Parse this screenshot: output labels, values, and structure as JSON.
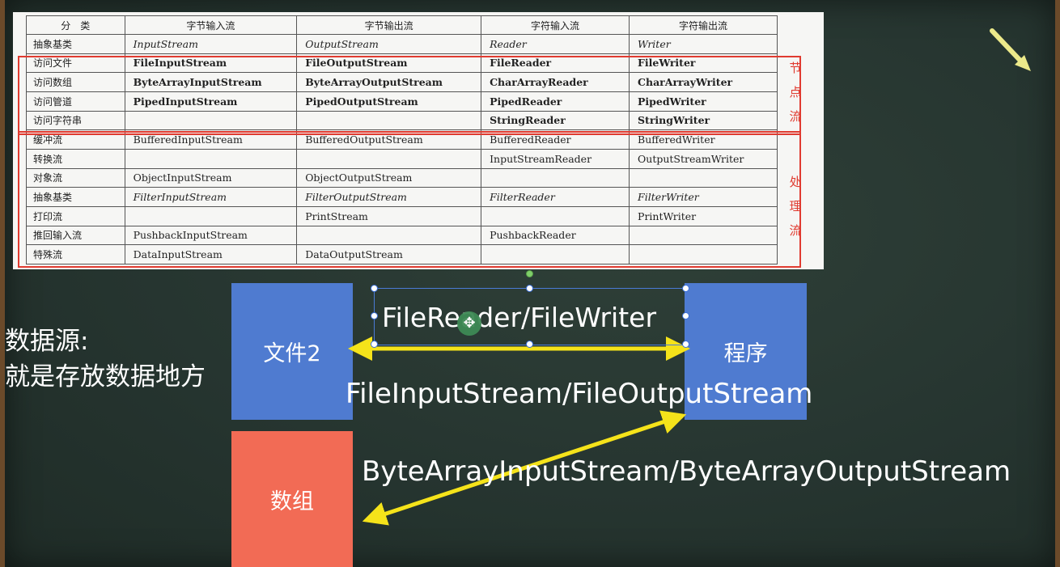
{
  "table": {
    "headers": [
      "分　类",
      "字节输入流",
      "字节输出流",
      "字符输入流",
      "字符输出流"
    ],
    "rows": [
      {
        "cat": "抽象基类",
        "style": "abstract",
        "cells": [
          "InputStream",
          "OutputStream",
          "Reader",
          "Writer"
        ]
      },
      {
        "cat": "访问文件",
        "style": "node",
        "cells": [
          "FileInputStream",
          "FileOutputStream",
          "FileReader",
          "FileWriter"
        ]
      },
      {
        "cat": "访问数组",
        "style": "node",
        "cells": [
          "ByteArrayInputStream",
          "ByteArrayOutputStream",
          "CharArrayReader",
          "CharArrayWriter"
        ]
      },
      {
        "cat": "访问管道",
        "style": "node",
        "cells": [
          "PipedInputStream",
          "PipedOutputStream",
          "PipedReader",
          "PipedWriter"
        ]
      },
      {
        "cat": "访问字符串",
        "style": "node",
        "cells": [
          "",
          "",
          "StringReader",
          "StringWriter"
        ]
      },
      {
        "cat": "缓冲流",
        "style": "plain",
        "cells": [
          "BufferedInputStream",
          "BufferedOutputStream",
          "BufferedReader",
          "BufferedWriter"
        ]
      },
      {
        "cat": "转换流",
        "style": "plain",
        "cells": [
          "",
          "",
          "InputStreamReader",
          "OutputStreamWriter"
        ]
      },
      {
        "cat": "对象流",
        "style": "plain",
        "cells": [
          "ObjectInputStream",
          "ObjectOutputStream",
          "",
          ""
        ]
      },
      {
        "cat": "抽象基类",
        "style": "abstract",
        "cells": [
          "FilterInputStream",
          "FilterOutputStream",
          "FilterReader",
          "FilterWriter"
        ]
      },
      {
        "cat": "打印流",
        "style": "plain",
        "cells": [
          "",
          "PrintStream",
          "",
          "PrintWriter"
        ]
      },
      {
        "cat": "推回输入流",
        "style": "plain",
        "cells": [
          "PushbackInputStream",
          "",
          "PushbackReader",
          ""
        ]
      },
      {
        "cat": "特殊流",
        "style": "plain",
        "cells": [
          "DataInputStream",
          "DataOutputStream",
          "",
          ""
        ]
      }
    ],
    "node_stream_label": [
      "节",
      "点",
      "流"
    ],
    "processing_stream_label": [
      "处",
      "理",
      "流"
    ]
  },
  "diagram": {
    "source_title": "数据源:",
    "source_desc": "就是存放数据地方",
    "file_block": "文件2",
    "program_block": "程序",
    "array_block": "数组",
    "reader_writer": "FileReader/FileWriter",
    "input_output": "FileInputStream/FileOutputStream",
    "byte_array": "ByteArrayInputStream/ByteArrayOutputStream"
  },
  "colors": {
    "board": "#2a3a33",
    "blue_block": "#4f7bd0",
    "red_block": "#f26b55",
    "arrow": "#f5e31a",
    "highlight_box": "#e03b30"
  }
}
